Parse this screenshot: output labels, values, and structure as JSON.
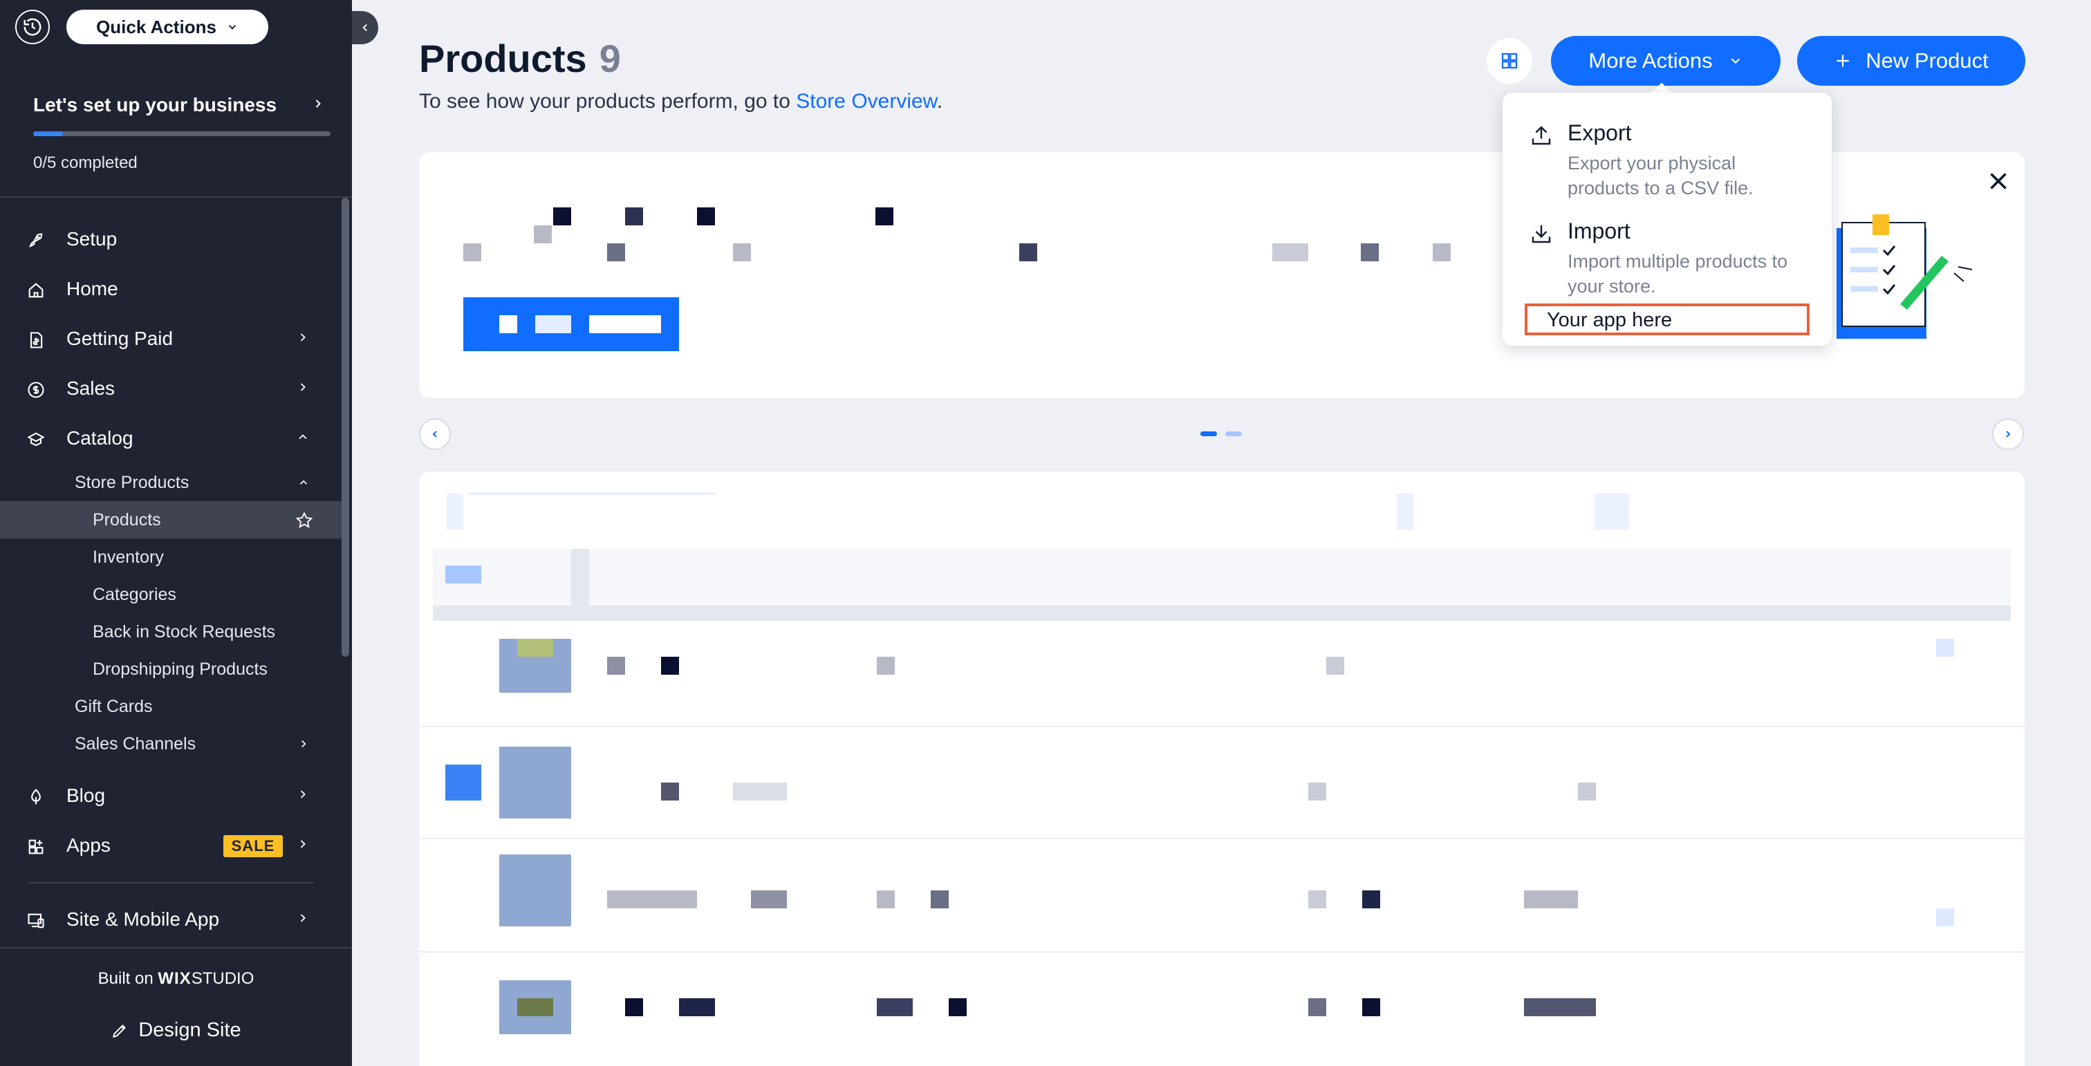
{
  "sidebar": {
    "quick_actions_label": "Quick Actions",
    "setup_title": "Let's set up your business",
    "setup_progress": 0.1,
    "setup_count": "0/5 completed",
    "nav": {
      "setup": "Setup",
      "home": "Home",
      "getting_paid": "Getting Paid",
      "sales": "Sales",
      "catalog": "Catalog",
      "store_products": "Store Products",
      "products": "Products",
      "inventory": "Inventory",
      "categories": "Categories",
      "back_in_stock": "Back in Stock Requests",
      "dropshipping": "Dropshipping Products",
      "gift_cards": "Gift Cards",
      "sales_channels": "Sales Channels",
      "blog": "Blog",
      "apps": "Apps",
      "apps_badge": "SALE",
      "site_mobile": "Site & Mobile App"
    },
    "footer": {
      "built_on": "Built on",
      "brand_wix": "WIX",
      "brand_studio": "STUDIO",
      "design_site": "Design Site"
    }
  },
  "header": {
    "title": "Products",
    "count": "9",
    "subtitle_prefix": "To see how your products perform, go to ",
    "subtitle_link": "Store Overview",
    "subtitle_suffix": ".",
    "more_actions_label": "More Actions",
    "new_product_label": "New Product"
  },
  "dropdown": {
    "export_title": "Export",
    "export_desc": "Export your physical products to a CSV file.",
    "import_title": "Import",
    "import_desc": "Import multiple products to your store.",
    "app_label": "Your app here"
  },
  "colors": {
    "accent": "#116dff",
    "sidebar_bg": "#1f2332",
    "highlight_border": "#e8613c",
    "sale_badge": "#fbbf24"
  }
}
